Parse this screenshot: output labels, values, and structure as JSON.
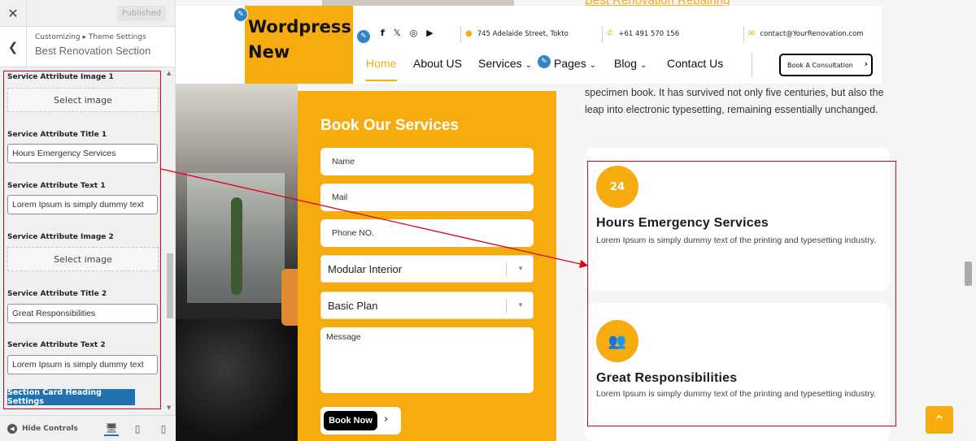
{
  "customizer": {
    "close_label": "✕",
    "published_label": "Published",
    "breadcrumb": "Customizing ▸ Theme Settings",
    "section_title": "Best Renovation Section",
    "fields": [
      {
        "label": "Service Attribute Image 1",
        "button": "Select image"
      },
      {
        "label": "Service Attribute Title 1",
        "value": "Hours Emergency Services"
      },
      {
        "label": "Service Attribute Text 1",
        "value": "Lorem Ipsum is simply dummy text"
      },
      {
        "label": "Service Attribute Image 2",
        "button": "Select image"
      },
      {
        "label": "Service Attribute Title 2",
        "value": "Great Responsibilities"
      },
      {
        "label": "Service Attribute Text 2",
        "value": "Lorem Ipsum is simply dummy text"
      }
    ],
    "heading_settings_button": "Section Card Heading Settings",
    "hide_controls": "Hide Controls"
  },
  "site": {
    "logo": "Wordpress New",
    "top_link": "Best Renovation Repairing",
    "address": "745 Adelaide Street, Tokto",
    "phone": "+61 491 570 156",
    "email": "contact@YourRenovation.com",
    "nav": [
      {
        "label": "Home"
      },
      {
        "label": "About US"
      },
      {
        "label": "Services"
      },
      {
        "label": "Pages"
      },
      {
        "label": "Blog"
      },
      {
        "label": "Contact Us"
      }
    ],
    "consult_button": "Book A Consultation",
    "form": {
      "title": "Book Our Services",
      "name_placeholder": "Name",
      "mail_placeholder": "Mail",
      "phone_placeholder": "Phone NO.",
      "interior_select": "Modular Interior",
      "plan_select": "Basic Plan",
      "message_placeholder": "Message",
      "submit": "Book Now"
    },
    "paragraph": "specimen book. It has survived not only five centuries, but also the leap into electronic typesetting, remaining essentially unchanged.",
    "cards": [
      {
        "icon_text": "24",
        "title": "Hours Emergency Services",
        "text": "Lorem Ipsum is simply dummy text of the printing and typesetting industry."
      },
      {
        "title": "Great Responsibilities",
        "text": "Lorem Ipsum is simply dummy text of the printing and typesetting industry."
      }
    ]
  },
  "colors": {
    "accent": "#f6ac0f",
    "annotation": "#e1001a",
    "wp_blue": "#2271b1"
  }
}
